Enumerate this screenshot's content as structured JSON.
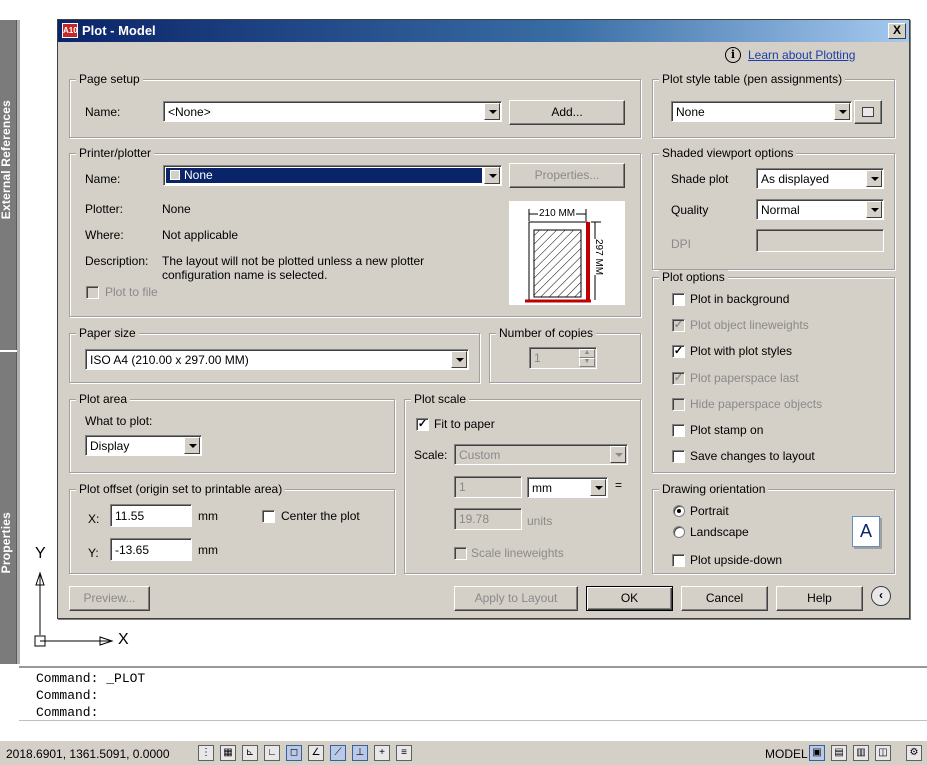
{
  "palettes": {
    "external_references": "External References",
    "properties": "Properties"
  },
  "ucs": {
    "y": "Y",
    "x": "X"
  },
  "dialog": {
    "title": "Plot - Model",
    "app_logo": "A10",
    "close": "X",
    "help_link": "Learn about Plotting",
    "page_setup": {
      "title": "Page setup",
      "name_label": "Name:",
      "name_value": "<None>",
      "add_button": "Add..."
    },
    "printer": {
      "title": "Printer/plotter",
      "name_label": "Name:",
      "name_value": "None",
      "properties_button": "Properties...",
      "plotter_label": "Plotter:",
      "plotter_value": "None",
      "where_label": "Where:",
      "where_value": "Not applicable",
      "description_label": "Description:",
      "description_line1": "The layout will not be plotted unless a new plotter",
      "description_line2": "configuration name is selected.",
      "plot_to_file": "Plot to file",
      "preview_width": "210 MM",
      "preview_height": "297 MM"
    },
    "paper_size": {
      "title": "Paper size",
      "value": "ISO A4 (210.00 x 297.00 MM)"
    },
    "copies": {
      "title": "Number of copies",
      "value": "1"
    },
    "plot_area": {
      "title": "Plot area",
      "what_label": "What to plot:",
      "what_value": "Display"
    },
    "plot_offset": {
      "title": "Plot offset (origin set to printable area)",
      "x_label": "X:",
      "x_value": "11.55",
      "x_unit": "mm",
      "y_label": "Y:",
      "y_value": "-13.65",
      "y_unit": "mm",
      "center": "Center the plot"
    },
    "plot_scale": {
      "title": "Plot scale",
      "fit": "Fit to paper",
      "scale_label": "Scale:",
      "scale_value": "Custom",
      "num": "1",
      "unit": "mm",
      "equals": "=",
      "den": "19.78",
      "units_label": "units",
      "lineweights": "Scale lineweights"
    },
    "plot_style": {
      "title": "Plot style table (pen assignments)",
      "value": "None"
    },
    "shaded": {
      "title": "Shaded viewport options",
      "shade_label": "Shade plot",
      "shade_value": "As displayed",
      "quality_label": "Quality",
      "quality_value": "Normal",
      "dpi_label": "DPI"
    },
    "plot_options": {
      "title": "Plot options",
      "items": [
        {
          "label": "Plot in background",
          "checked": false,
          "enabled": true
        },
        {
          "label": "Plot object lineweights",
          "checked": true,
          "enabled": false
        },
        {
          "label": "Plot with plot styles",
          "checked": true,
          "enabled": true
        },
        {
          "label": "Plot paperspace last",
          "checked": true,
          "enabled": false
        },
        {
          "label": "Hide paperspace objects",
          "checked": false,
          "enabled": false
        },
        {
          "label": "Plot stamp on",
          "checked": false,
          "enabled": true
        },
        {
          "label": "Save changes to layout",
          "checked": false,
          "enabled": true
        }
      ]
    },
    "orientation": {
      "title": "Drawing orientation",
      "portrait": "Portrait",
      "landscape": "Landscape",
      "upside_down": "Plot upside-down",
      "icon_letter": "A"
    },
    "buttons": {
      "preview": "Preview...",
      "apply": "Apply to Layout",
      "ok": "OK",
      "cancel": "Cancel",
      "help": "Help"
    }
  },
  "command_line": [
    "Command:  _PLOT",
    "Command:",
    "Command:"
  ],
  "status": {
    "coords": "2018.6901, 1361.5091, 0.0000",
    "model": "MODEL"
  }
}
